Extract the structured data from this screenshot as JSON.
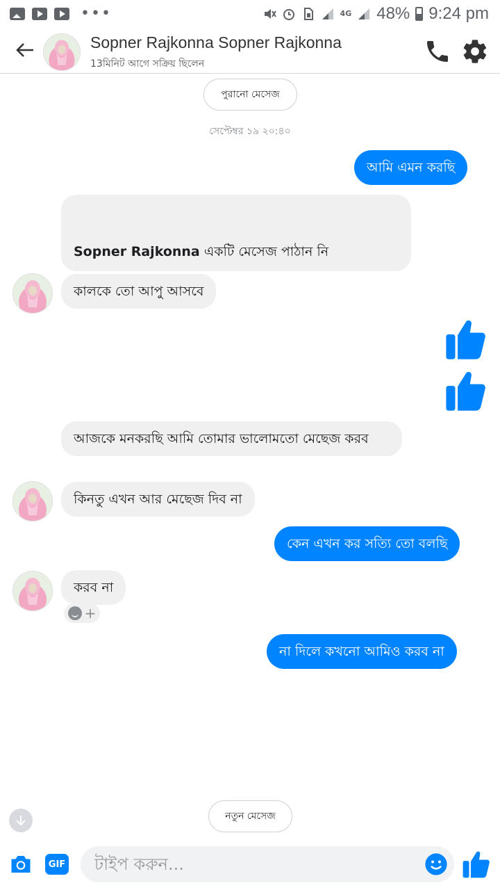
{
  "status_bar": {
    "battery": "48%",
    "time": "9:24 pm",
    "network": "4G"
  },
  "header": {
    "title": "Sopner Rajkonna Sopner Rajkonna",
    "subtitle": "13মিনিট আগে সক্রিয় ছিলেন"
  },
  "conversation": {
    "older_messages_button": "পুরানো মেসেজ",
    "timestamp": "সেপ্টেম্বর ১৯ ২০:৪০",
    "messages": [
      {
        "sender": "me",
        "text": "আমি এমন করছি"
      },
      {
        "sender": "them",
        "name": "Sopner Rajkonna",
        "text": "একটি মেসেজ পাঠান নি"
      },
      {
        "sender": "them",
        "text": "কালকে তো আপু আসবে"
      },
      {
        "sender": "me",
        "type": "like"
      },
      {
        "sender": "me",
        "type": "like"
      },
      {
        "sender": "them",
        "text": "আজকে মনকরছি আমি তোমার  ভালোমতো মেছেজ করব"
      },
      {
        "sender": "them",
        "text": "কিনতু এখন আর মেছেজ দিব না"
      },
      {
        "sender": "me",
        "text": "কেন এখন কর সত্যি তো বলছি"
      },
      {
        "sender": "them",
        "text": "করব না"
      },
      {
        "sender": "me",
        "text": "না দিলে কখনো আমিও করব না"
      }
    ],
    "reaction_plus": "+",
    "new_messages_button": "নতুন মেসেজ"
  },
  "composer": {
    "gif_label": "GIF",
    "placeholder": "টাইপ করুন..."
  },
  "colors": {
    "accent": "#0084ff",
    "incoming_bubble": "#f1f0f0"
  },
  "icons": [
    "back-arrow-icon",
    "phone-icon",
    "gear-icon",
    "thumbs-up-icon",
    "camera-icon",
    "emoji-icon",
    "arrow-down-icon"
  ]
}
